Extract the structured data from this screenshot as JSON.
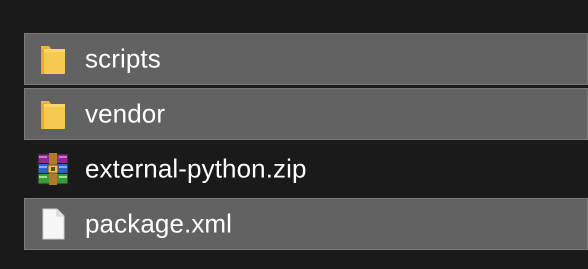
{
  "file_list": {
    "items": [
      {
        "name": "scripts",
        "icon": "folder-icon",
        "selected": true
      },
      {
        "name": "vendor",
        "icon": "folder-icon",
        "selected": true
      },
      {
        "name": "external-python.zip",
        "icon": "winrar-archive-icon",
        "selected": false
      },
      {
        "name": "package.xml",
        "icon": "document-icon",
        "selected": true
      }
    ]
  },
  "colors": {
    "background": "#1a1a1a",
    "selection": "#626262",
    "selection_border": "#7a7a7a",
    "folder": "#f4c24b",
    "text": "#ffffff"
  }
}
